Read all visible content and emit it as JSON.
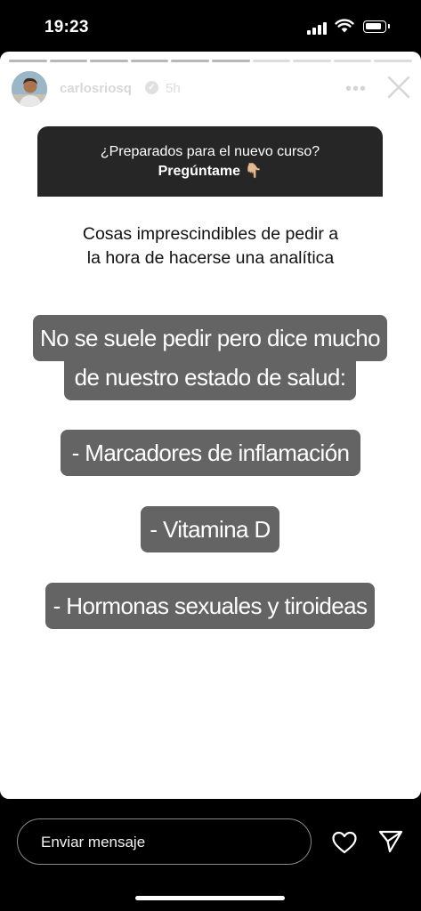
{
  "status": {
    "time": "19:23"
  },
  "story": {
    "username": "carlosriosq",
    "time_ago": "5h",
    "progress_total": 10,
    "progress_done": 6
  },
  "question": {
    "line1": "¿Preparados para el nuevo curso?",
    "line2": "Pregúntame 👇🏼"
  },
  "intro": {
    "line1": "Cosas imprescindibles de pedir a",
    "line2": "la hora de hacerse una analítica"
  },
  "captions": {
    "line1": "No se suele pedir pero dice mucho",
    "line2": "de nuestro estado de salud:",
    "item1": "- Marcadores de inflamación",
    "item2": "- Vitamina D",
    "item3": "- Hormonas sexuales y tiroideas"
  },
  "reply": {
    "placeholder": "Enviar mensaje"
  },
  "icons": {
    "more": "more-horizontal-icon",
    "close": "close-icon",
    "heart": "heart-icon",
    "send": "send-icon"
  }
}
